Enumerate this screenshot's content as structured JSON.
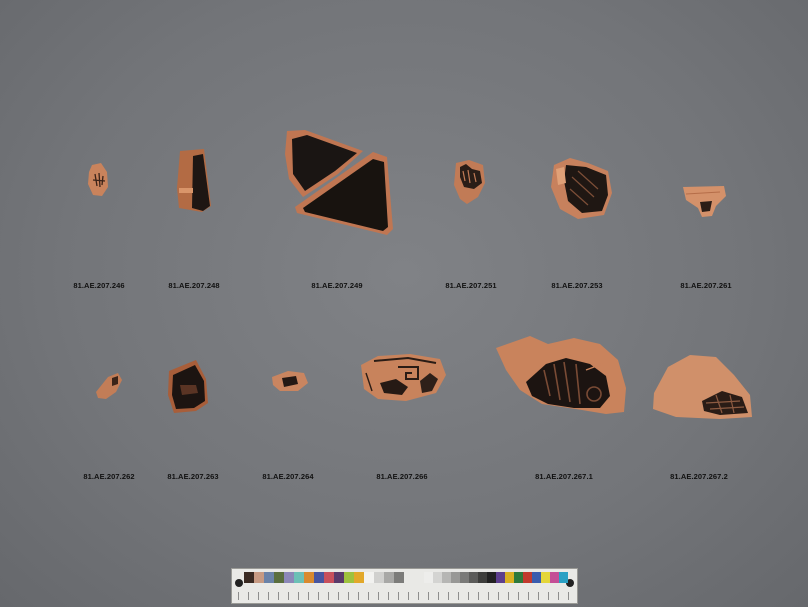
{
  "fragments_row1": [
    {
      "label": "81.AE.207.246"
    },
    {
      "label": "81.AE.207.248"
    },
    {
      "label": "81.AE.207.249"
    },
    {
      "label": "81.AE.207.251"
    },
    {
      "label": "81.AE.207.253"
    },
    {
      "label": "81.AE.207.261"
    }
  ],
  "fragments_row2": [
    {
      "label": "81.AE.207.262"
    },
    {
      "label": "81.AE.207.263"
    },
    {
      "label": "81.AE.207.264"
    },
    {
      "label": "81.AE.207.266"
    },
    {
      "label": "81.AE.207.267.1"
    },
    {
      "label": "81.AE.207.267.2"
    }
  ],
  "colors": {
    "background": "#75777b",
    "terracotta": "#c9825a",
    "black_glaze": "#1c1412"
  }
}
